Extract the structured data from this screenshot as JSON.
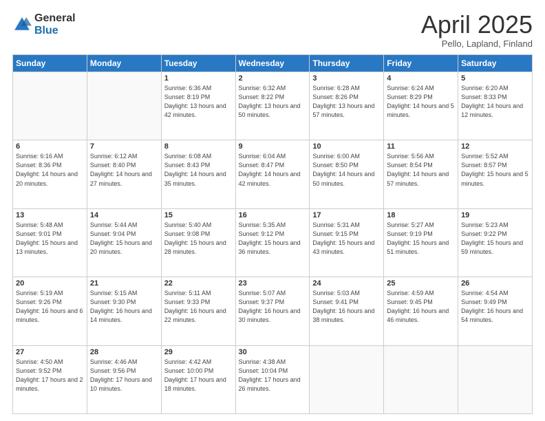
{
  "logo": {
    "general": "General",
    "blue": "Blue"
  },
  "header": {
    "month": "April 2025",
    "location": "Pello, Lapland, Finland"
  },
  "weekdays": [
    "Sunday",
    "Monday",
    "Tuesday",
    "Wednesday",
    "Thursday",
    "Friday",
    "Saturday"
  ],
  "weeks": [
    [
      {
        "day": "",
        "sunrise": "",
        "sunset": "",
        "daylight": ""
      },
      {
        "day": "",
        "sunrise": "",
        "sunset": "",
        "daylight": ""
      },
      {
        "day": "1",
        "sunrise": "Sunrise: 6:36 AM",
        "sunset": "Sunset: 8:19 PM",
        "daylight": "Daylight: 13 hours and 42 minutes."
      },
      {
        "day": "2",
        "sunrise": "Sunrise: 6:32 AM",
        "sunset": "Sunset: 8:22 PM",
        "daylight": "Daylight: 13 hours and 50 minutes."
      },
      {
        "day": "3",
        "sunrise": "Sunrise: 6:28 AM",
        "sunset": "Sunset: 8:26 PM",
        "daylight": "Daylight: 13 hours and 57 minutes."
      },
      {
        "day": "4",
        "sunrise": "Sunrise: 6:24 AM",
        "sunset": "Sunset: 8:29 PM",
        "daylight": "Daylight: 14 hours and 5 minutes."
      },
      {
        "day": "5",
        "sunrise": "Sunrise: 6:20 AM",
        "sunset": "Sunset: 8:33 PM",
        "daylight": "Daylight: 14 hours and 12 minutes."
      }
    ],
    [
      {
        "day": "6",
        "sunrise": "Sunrise: 6:16 AM",
        "sunset": "Sunset: 8:36 PM",
        "daylight": "Daylight: 14 hours and 20 minutes."
      },
      {
        "day": "7",
        "sunrise": "Sunrise: 6:12 AM",
        "sunset": "Sunset: 8:40 PM",
        "daylight": "Daylight: 14 hours and 27 minutes."
      },
      {
        "day": "8",
        "sunrise": "Sunrise: 6:08 AM",
        "sunset": "Sunset: 8:43 PM",
        "daylight": "Daylight: 14 hours and 35 minutes."
      },
      {
        "day": "9",
        "sunrise": "Sunrise: 6:04 AM",
        "sunset": "Sunset: 8:47 PM",
        "daylight": "Daylight: 14 hours and 42 minutes."
      },
      {
        "day": "10",
        "sunrise": "Sunrise: 6:00 AM",
        "sunset": "Sunset: 8:50 PM",
        "daylight": "Daylight: 14 hours and 50 minutes."
      },
      {
        "day": "11",
        "sunrise": "Sunrise: 5:56 AM",
        "sunset": "Sunset: 8:54 PM",
        "daylight": "Daylight: 14 hours and 57 minutes."
      },
      {
        "day": "12",
        "sunrise": "Sunrise: 5:52 AM",
        "sunset": "Sunset: 8:57 PM",
        "daylight": "Daylight: 15 hours and 5 minutes."
      }
    ],
    [
      {
        "day": "13",
        "sunrise": "Sunrise: 5:48 AM",
        "sunset": "Sunset: 9:01 PM",
        "daylight": "Daylight: 15 hours and 13 minutes."
      },
      {
        "day": "14",
        "sunrise": "Sunrise: 5:44 AM",
        "sunset": "Sunset: 9:04 PM",
        "daylight": "Daylight: 15 hours and 20 minutes."
      },
      {
        "day": "15",
        "sunrise": "Sunrise: 5:40 AM",
        "sunset": "Sunset: 9:08 PM",
        "daylight": "Daylight: 15 hours and 28 minutes."
      },
      {
        "day": "16",
        "sunrise": "Sunrise: 5:35 AM",
        "sunset": "Sunset: 9:12 PM",
        "daylight": "Daylight: 15 hours and 36 minutes."
      },
      {
        "day": "17",
        "sunrise": "Sunrise: 5:31 AM",
        "sunset": "Sunset: 9:15 PM",
        "daylight": "Daylight: 15 hours and 43 minutes."
      },
      {
        "day": "18",
        "sunrise": "Sunrise: 5:27 AM",
        "sunset": "Sunset: 9:19 PM",
        "daylight": "Daylight: 15 hours and 51 minutes."
      },
      {
        "day": "19",
        "sunrise": "Sunrise: 5:23 AM",
        "sunset": "Sunset: 9:22 PM",
        "daylight": "Daylight: 15 hours and 59 minutes."
      }
    ],
    [
      {
        "day": "20",
        "sunrise": "Sunrise: 5:19 AM",
        "sunset": "Sunset: 9:26 PM",
        "daylight": "Daylight: 16 hours and 6 minutes."
      },
      {
        "day": "21",
        "sunrise": "Sunrise: 5:15 AM",
        "sunset": "Sunset: 9:30 PM",
        "daylight": "Daylight: 16 hours and 14 minutes."
      },
      {
        "day": "22",
        "sunrise": "Sunrise: 5:11 AM",
        "sunset": "Sunset: 9:33 PM",
        "daylight": "Daylight: 16 hours and 22 minutes."
      },
      {
        "day": "23",
        "sunrise": "Sunrise: 5:07 AM",
        "sunset": "Sunset: 9:37 PM",
        "daylight": "Daylight: 16 hours and 30 minutes."
      },
      {
        "day": "24",
        "sunrise": "Sunrise: 5:03 AM",
        "sunset": "Sunset: 9:41 PM",
        "daylight": "Daylight: 16 hours and 38 minutes."
      },
      {
        "day": "25",
        "sunrise": "Sunrise: 4:59 AM",
        "sunset": "Sunset: 9:45 PM",
        "daylight": "Daylight: 16 hours and 46 minutes."
      },
      {
        "day": "26",
        "sunrise": "Sunrise: 4:54 AM",
        "sunset": "Sunset: 9:49 PM",
        "daylight": "Daylight: 16 hours and 54 minutes."
      }
    ],
    [
      {
        "day": "27",
        "sunrise": "Sunrise: 4:50 AM",
        "sunset": "Sunset: 9:52 PM",
        "daylight": "Daylight: 17 hours and 2 minutes."
      },
      {
        "day": "28",
        "sunrise": "Sunrise: 4:46 AM",
        "sunset": "Sunset: 9:56 PM",
        "daylight": "Daylight: 17 hours and 10 minutes."
      },
      {
        "day": "29",
        "sunrise": "Sunrise: 4:42 AM",
        "sunset": "Sunset: 10:00 PM",
        "daylight": "Daylight: 17 hours and 18 minutes."
      },
      {
        "day": "30",
        "sunrise": "Sunrise: 4:38 AM",
        "sunset": "Sunset: 10:04 PM",
        "daylight": "Daylight: 17 hours and 26 minutes."
      },
      {
        "day": "",
        "sunrise": "",
        "sunset": "",
        "daylight": ""
      },
      {
        "day": "",
        "sunrise": "",
        "sunset": "",
        "daylight": ""
      },
      {
        "day": "",
        "sunrise": "",
        "sunset": "",
        "daylight": ""
      }
    ]
  ]
}
